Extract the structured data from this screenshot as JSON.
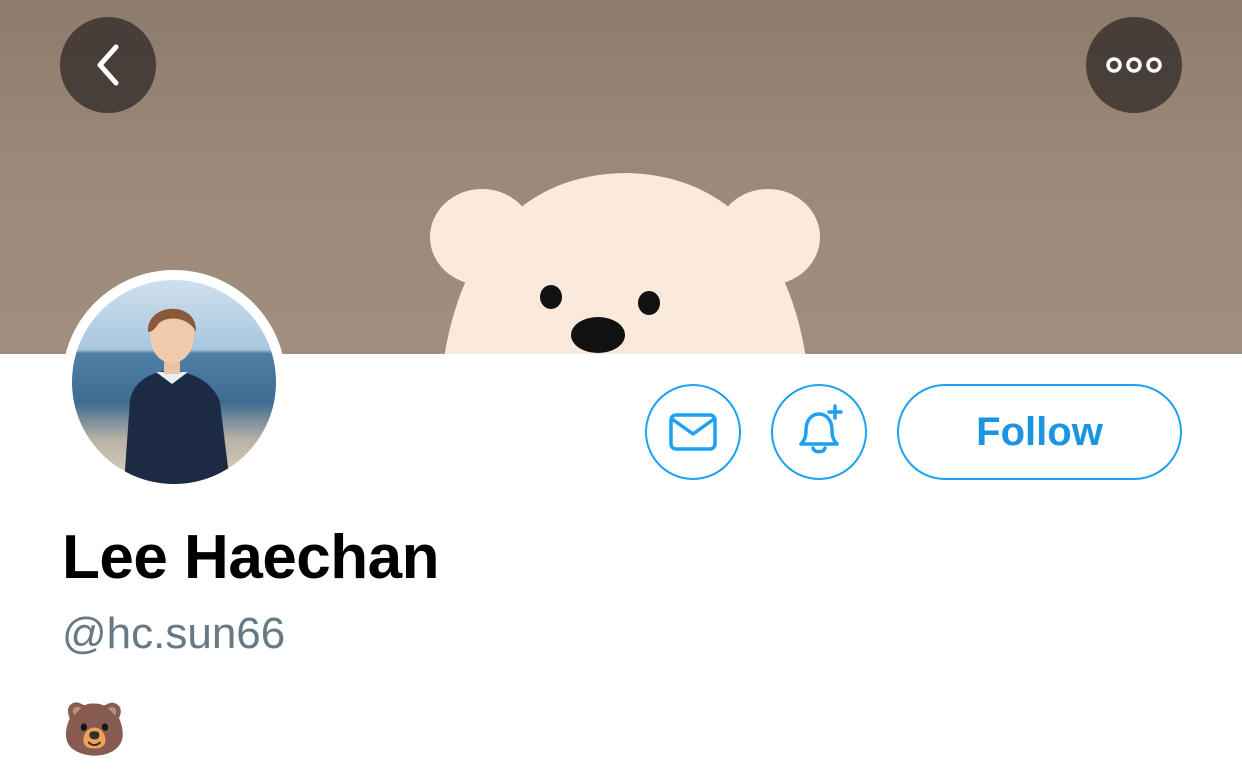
{
  "banner": {
    "back_icon": "chevron-left-icon",
    "more_icon": "ellipsis-icon"
  },
  "profile": {
    "name": "Lee Haechan",
    "handle": "@hc.sun66",
    "bio": "🐻"
  },
  "actions": {
    "message_icon": "envelope-icon",
    "notify_icon": "bell-plus-icon",
    "follow_label": "Follow"
  },
  "colors": {
    "accent": "#1da1f2",
    "handle": "#667985",
    "banner": "#9b8878"
  }
}
